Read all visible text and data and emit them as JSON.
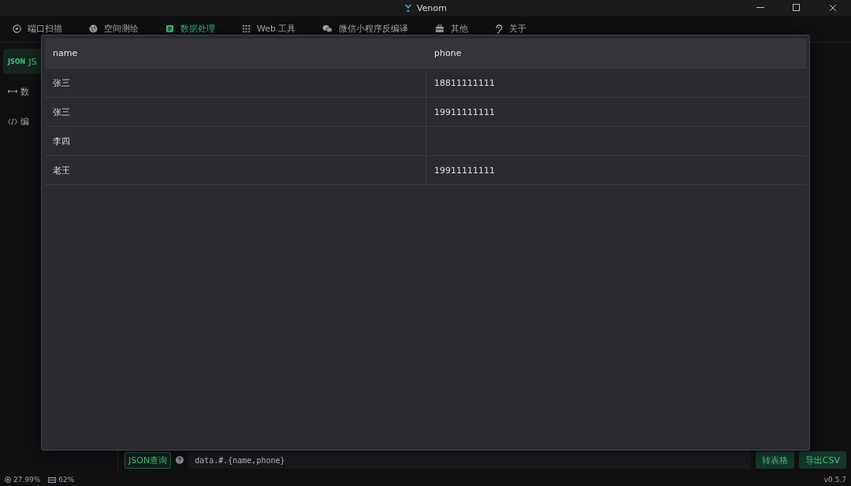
{
  "window": {
    "title": "Venom"
  },
  "tabs": [
    {
      "label": "端口扫描",
      "selected": false
    },
    {
      "label": "空间测绘",
      "selected": false
    },
    {
      "label": "数据处理",
      "selected": true
    },
    {
      "label": "Web 工具",
      "selected": false
    },
    {
      "label": "微信小程序反编译",
      "selected": false
    },
    {
      "label": "其他",
      "selected": false
    },
    {
      "label": "关于",
      "selected": false
    }
  ],
  "sidebar": {
    "items": [
      {
        "badge": "JSON",
        "label": "JS",
        "selected": true
      },
      {
        "label": "数",
        "selected": false
      },
      {
        "label": "编",
        "selected": false
      }
    ]
  },
  "query": {
    "tag": "JSON查询",
    "value": "data.#.{name,phone}",
    "buttons": [
      "转表格",
      "导出CSV"
    ]
  },
  "modal": {
    "table": {
      "columns": [
        "name",
        "phone"
      ],
      "rows": [
        [
          "张三",
          "18811111111"
        ],
        [
          "张三",
          "19911111111"
        ],
        [
          "李四",
          ""
        ],
        [
          "老王",
          "19911111111"
        ]
      ]
    }
  },
  "status_bar": {
    "cpu": "27.99%",
    "memory": "62%",
    "version": "v0.5.7"
  }
}
